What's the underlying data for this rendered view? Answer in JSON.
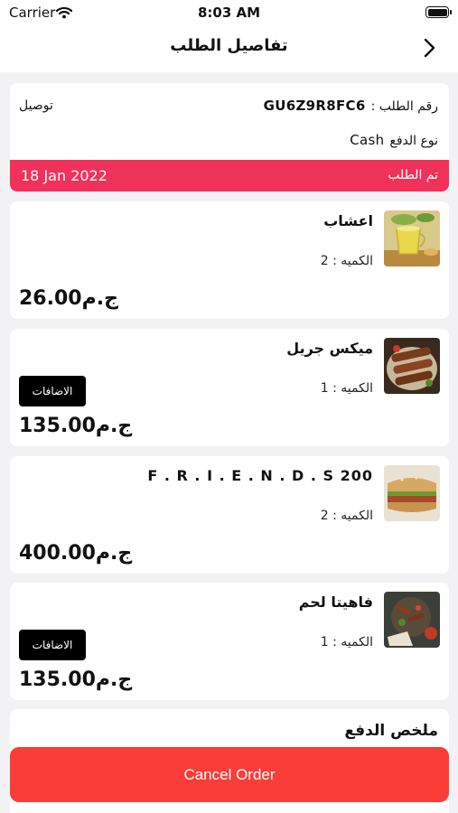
{
  "status_bar": {
    "carrier": "Carrier",
    "time": "8:03 AM"
  },
  "nav": {
    "title": "تفاصيل الطلب"
  },
  "order": {
    "number_label": "رقم الطلب :",
    "number": "GU6Z9R8FC6",
    "delivery_type": "توصيل",
    "payment_label": "نوع الدفع",
    "payment_value": "Cash",
    "status": "تم الطلب",
    "date": "18 Jan 2022",
    "status_color": "#f0325a"
  },
  "items": [
    {
      "name": "اعشاب",
      "qty": "الكميه : 2",
      "price": "26.00ج.م",
      "has_addons": false,
      "icon": "herbal-tea"
    },
    {
      "name": "ميكس جريل",
      "qty": "الكميه : 1",
      "price": "135.00ج.م",
      "has_addons": true,
      "addons_label": "الاضافات",
      "icon": "mixed-grill"
    },
    {
      "name": "F . R . I . E . N . D . S 200",
      "qty": "الكميه : 2",
      "price": "400.00ج.م",
      "has_addons": false,
      "icon": "sandwich"
    },
    {
      "name": "فاهيتا لحم",
      "qty": "الكميه : 1",
      "price": "135.00ج.م",
      "has_addons": true,
      "addons_label": "الاضافات",
      "icon": "fajita"
    }
  ],
  "summary": {
    "title": "ملخص الدفع"
  },
  "cancel_button": {
    "label": "Cancel Order",
    "color": "#fb3d37"
  }
}
